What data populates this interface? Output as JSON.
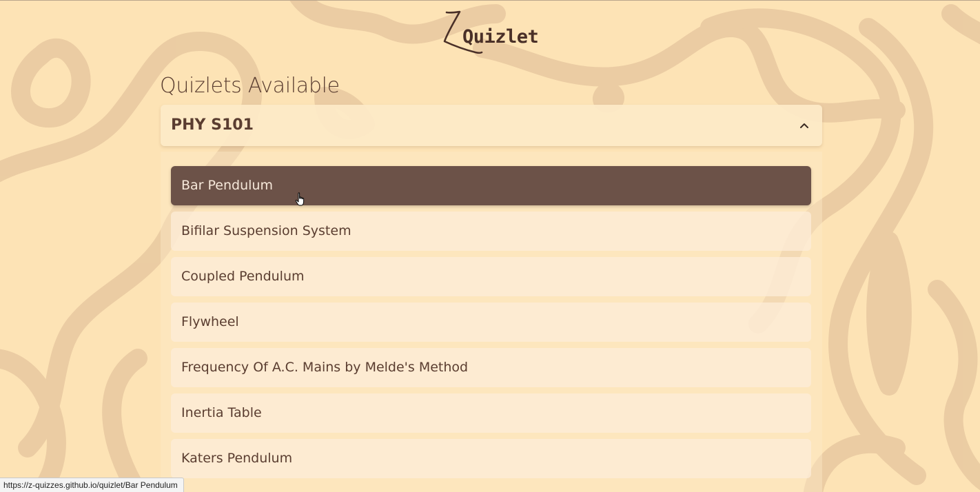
{
  "app": {
    "logo_text": "Quizlet"
  },
  "page": {
    "section_title": "Quizlets Available"
  },
  "accordion": {
    "title": "PHY S101",
    "expanded": true,
    "icon": "chevron-up-icon"
  },
  "items": [
    {
      "label": "Bar Pendulum",
      "active": true
    },
    {
      "label": "Bifilar Suspension System",
      "active": false
    },
    {
      "label": "Coupled Pendulum",
      "active": false
    },
    {
      "label": "Flywheel",
      "active": false
    },
    {
      "label": "Frequency Of A.C. Mains by Melde's Method",
      "active": false
    },
    {
      "label": "Inertia Table",
      "active": false
    },
    {
      "label": "Katers Pendulum",
      "active": false
    }
  ],
  "status_bar": {
    "url": "https://z-quizzes.github.io/quizlet/Bar Pendulum"
  },
  "colors": {
    "background": "#fde3b5",
    "active_item": "#6c5248",
    "text": "#5a3d30"
  }
}
